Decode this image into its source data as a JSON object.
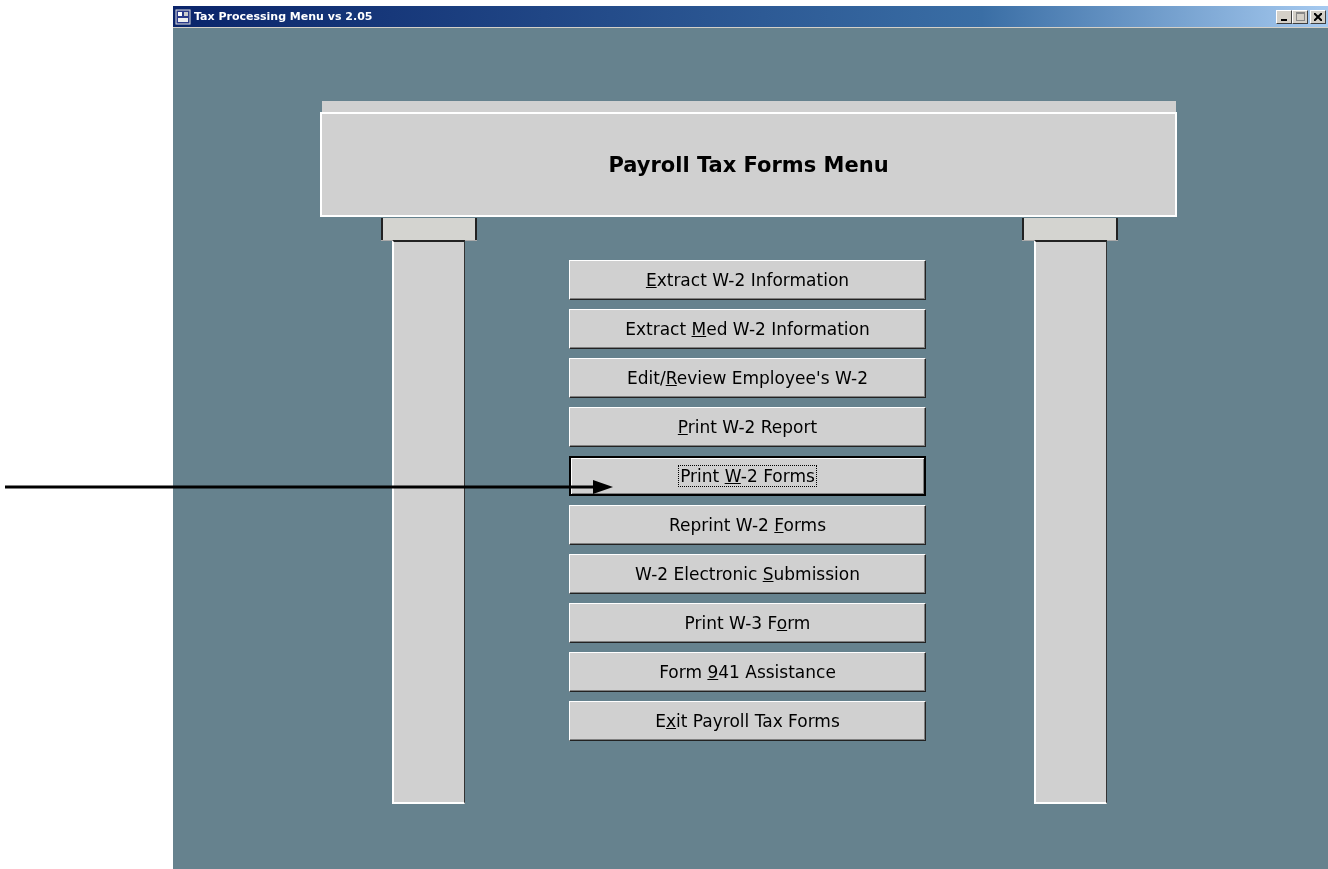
{
  "window": {
    "title": "Tax Processing Menu vs 2.05"
  },
  "menu": {
    "title": "Payroll Tax Forms Menu",
    "buttons": [
      {
        "key": "E",
        "after": "xtract W-2 Information",
        "focused": false
      },
      {
        "before": "Extract ",
        "key": "M",
        "after": "ed W-2 Information",
        "focused": false
      },
      {
        "before": "Edit/",
        "key": "R",
        "after": "eview Employee's W-2",
        "focused": false
      },
      {
        "key": "P",
        "after": "rint W-2 Report",
        "focused": false
      },
      {
        "before": "Print ",
        "key": "W",
        "after": "-2 Forms",
        "focused": true
      },
      {
        "before": "Reprint W-2 ",
        "key": "F",
        "after": "orms",
        "focused": false
      },
      {
        "before": "W-2 Electronic ",
        "key": "S",
        "after": "ubmission",
        "focused": false
      },
      {
        "before": "Print W-3 F",
        "key": "o",
        "after": "rm",
        "focused": false
      },
      {
        "before": "Form ",
        "key": "9",
        "after": "41 Assistance",
        "focused": false
      },
      {
        "before": "E",
        "key": "x",
        "after": "it Payroll Tax Forms",
        "focused": false
      }
    ]
  }
}
